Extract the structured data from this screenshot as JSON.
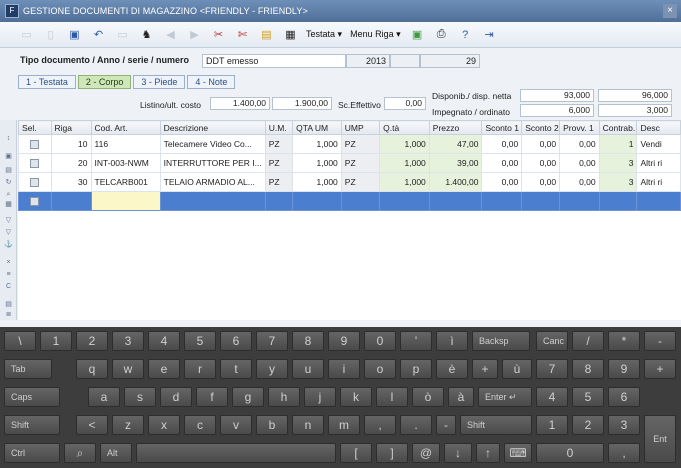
{
  "window": {
    "title": "GESTIONE DOCUMENTI DI MAGAZZINO <FRIENDLY - FRIENDLY>",
    "app_icon": "app-icon",
    "close_glyph": "×"
  },
  "toolbar": {
    "menu_testata": "Testata",
    "menu_riga": "Menu Riga",
    "icons": [
      "new-icon",
      "open-icon",
      "save-icon",
      "undo-icon",
      "copy-icon",
      "find-icon",
      "back-icon",
      "forward-icon",
      "cut-icon",
      "scissors-icon",
      "attach-icon",
      "document-icon",
      "dropdown-icon",
      "print-icon",
      "help-icon",
      "exit-icon"
    ]
  },
  "document": {
    "label": "Tipo documento / Anno / serie / numero",
    "type": "DDT emesso",
    "year": "2013",
    "number": "29"
  },
  "tabs": [
    {
      "label": "1 - Testata"
    },
    {
      "label": "2 - Corpo"
    },
    {
      "label": "3 - Piede"
    },
    {
      "label": "4 - Note"
    }
  ],
  "summary": {
    "listino_label": "Listino/ult. costo",
    "listino_value": "1.400,00",
    "ult_costo_value": "1.900,00",
    "sc_eff_label": "Sc.Effettivo",
    "sc_eff_value": "0,00",
    "disp_label": "Disponib./ disp. netta",
    "disp_value": "93,000",
    "disp_netta_value": "96,000",
    "impegnato_label": "Impegnato / ordinato",
    "impegnato_value": "6,000",
    "ordinato_value": "3,000"
  },
  "grid": {
    "columns": [
      "Sel.",
      "Riga",
      "Cod. Art.",
      "Descrizione",
      "U.M.",
      "QTA UM",
      "UMP",
      "Q.tà",
      "Prezzo",
      "Sconto 1",
      "Sconto 2",
      "Provv. 1",
      "Contrab.",
      "Desc"
    ],
    "rows": [
      {
        "riga": "10",
        "cod": "116",
        "desc": "Telecamere Video Co...",
        "um": "PZ",
        "qta_um": "1,000",
        "ump": "PZ",
        "qta": "1,000",
        "prezzo": "47,00",
        "sc1": "0,00",
        "sc2": "0,00",
        "provv": "0,00",
        "contr": "1",
        "descr": "Vendi"
      },
      {
        "riga": "20",
        "cod": "INT-003-NWM",
        "desc": "INTERRUTTORE PER I...",
        "um": "PZ",
        "qta_um": "1,000",
        "ump": "PZ",
        "qta": "1,000",
        "prezzo": "39,00",
        "sc1": "0,00",
        "sc2": "0,00",
        "provv": "0,00",
        "contr": "3",
        "descr": "Altri ri"
      },
      {
        "riga": "30",
        "cod": "TELCARB001",
        "desc": "TELAIO ARMADIO AL...",
        "um": "PZ",
        "qta_um": "1,000",
        "ump": "PZ",
        "qta": "1,000",
        "prezzo": "1.400,00",
        "sc1": "0,00",
        "sc2": "0,00",
        "provv": "0,00",
        "contr": "3",
        "descr": "Altri ri"
      }
    ]
  },
  "keyboard": {
    "row1": [
      "\\",
      "1",
      "2",
      "3",
      "4",
      "5",
      "6",
      "7",
      "8",
      "9",
      "0",
      "'",
      "ì",
      "Backsp",
      "Canc",
      "/",
      "*",
      "-"
    ],
    "row2": [
      "Tab",
      "q",
      "w",
      "e",
      "r",
      "t",
      "y",
      "u",
      "i",
      "o",
      "p",
      "è",
      "+",
      "ù",
      "7",
      "8",
      "9",
      "+"
    ],
    "row3": [
      "Caps",
      "a",
      "s",
      "d",
      "f",
      "g",
      "h",
      "j",
      "k",
      "l",
      "ò",
      "à",
      "Enter",
      "4",
      "5",
      "6"
    ],
    "row4": [
      "Shift",
      "<",
      "z",
      "x",
      "c",
      "v",
      "b",
      "n",
      "m",
      ",",
      ".",
      "-",
      "Shift",
      "1",
      "2",
      "3",
      "Ent"
    ],
    "row5": [
      "Ctrl",
      "Alt",
      "[",
      "]",
      "@",
      "0",
      ","
    ]
  }
}
